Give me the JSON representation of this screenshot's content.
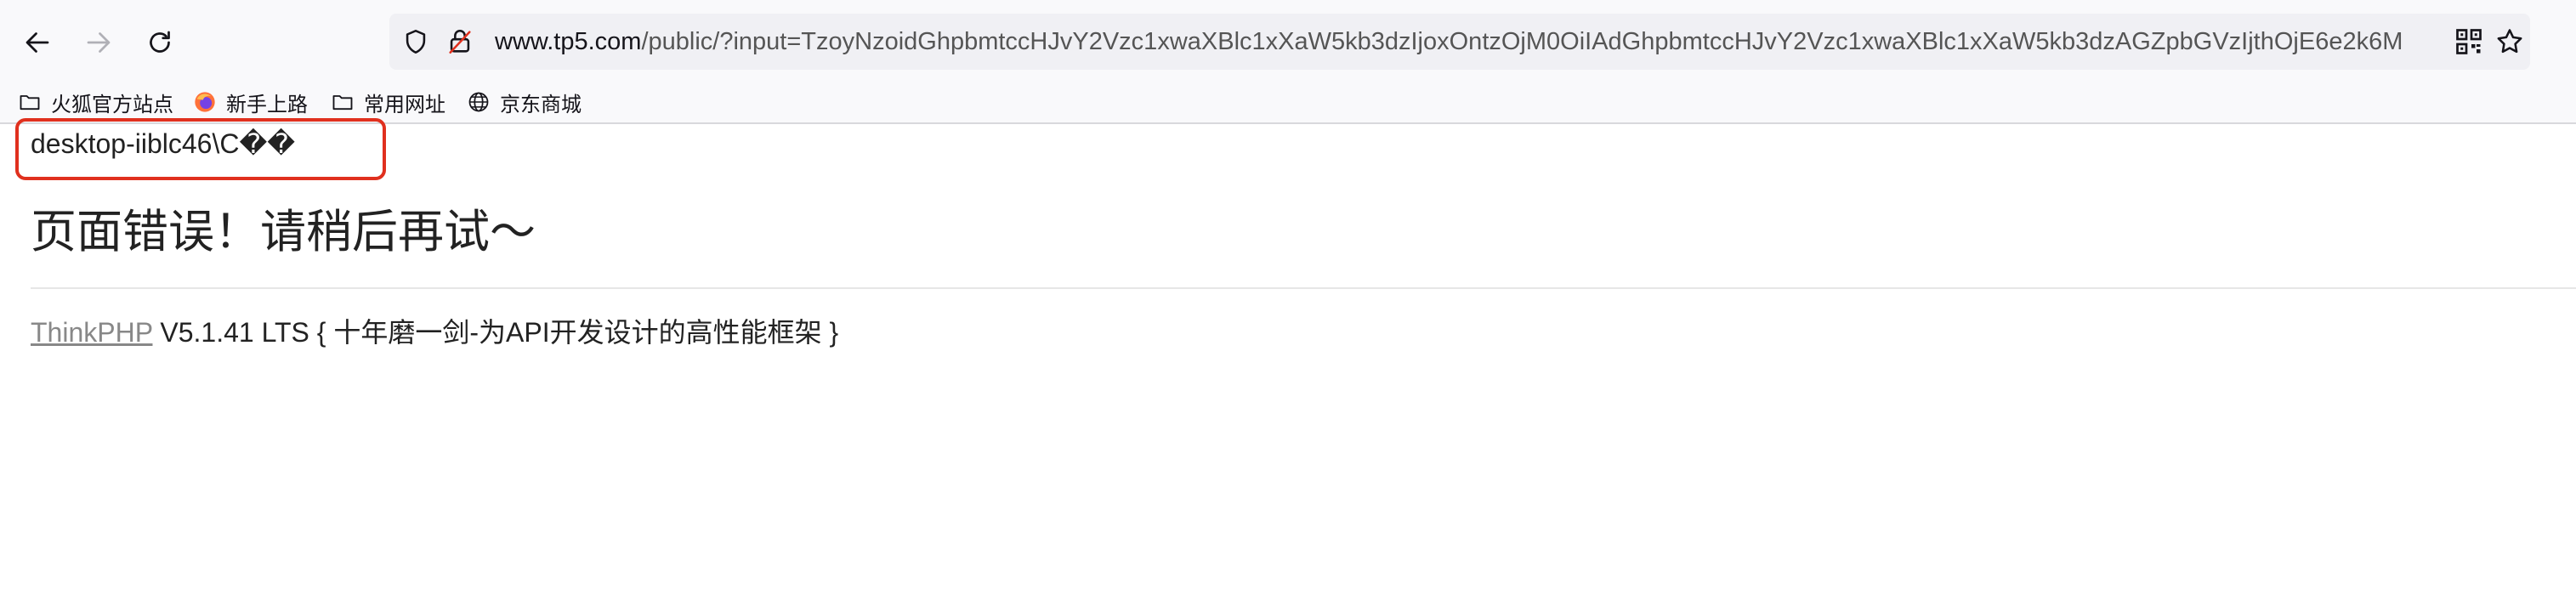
{
  "browser": {
    "url_host": "www.tp5.com",
    "url_rest": "/public/?input=TzoyNzoidGhpbmtccHJvY2Vzc1xwaXBlc1xXaW5kb3dzIjoxOntzOjM0OiIAdGhpbmtccHJvY2Vzc1xwaXBlc1xXaW5kb3dzAGZpbGVzIjthOjE6e2k6M"
  },
  "bookmarks": [
    {
      "label": "火狐官方站点",
      "icon": "folder-icon"
    },
    {
      "label": "新手上路",
      "icon": "firefox-icon"
    },
    {
      "label": "常用网址",
      "icon": "folder-icon"
    },
    {
      "label": "京东商城",
      "icon": "globe-icon"
    }
  ],
  "page": {
    "echo_output": "desktop-iiblc46\\C��",
    "error_title": "页面错误！请稍后再试～",
    "framework_link": "ThinkPHP",
    "framework_tagline": " V5.1.41 LTS { 十年磨一剑-为API开发设计的高性能框架 }"
  },
  "colors": {
    "highlight_box": "#e0301e",
    "link": "#888888",
    "toolbar_bg": "#f9f9fb",
    "urlbar_bg": "#f0f0f4"
  }
}
